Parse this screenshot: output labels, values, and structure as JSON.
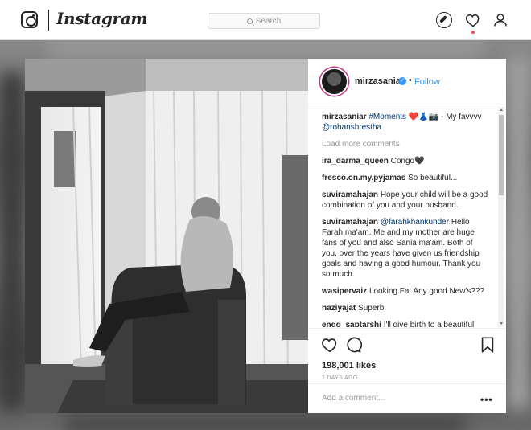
{
  "nav": {
    "logo_icon": "instagram-camera-icon",
    "brand": "Instagram",
    "search_placeholder": "Search",
    "icons": [
      "compass-icon",
      "heart-icon",
      "person-icon"
    ],
    "notification_dot_color": "#ed4956"
  },
  "post": {
    "author": "mirzasaniar",
    "verified_icon": "verified-badge-icon",
    "separator": "•",
    "follow_label": "Follow",
    "caption_user": "mirzasaniar",
    "caption_hashtag": "#Moments",
    "caption_emoji": "❤️👗📷",
    "caption_text": "- My favvvv",
    "caption_mention": "@rohanshrestha",
    "load_more": "Load more comments",
    "comments": [
      {
        "user": "ira_darma_queen",
        "text": "Congo🖤"
      },
      {
        "user": "fresco.on.my.pyjamas",
        "text": "So beautiful..."
      },
      {
        "user": "suviramahajan",
        "text": "Hope your child will be a good combination of you and your husband."
      },
      {
        "user": "suviramahajan",
        "mention": "@farahkhankunder",
        "text": "Hello Farah ma'am. Me and my mother are huge fans of you and also Sania ma'am. Both of you, over the years have given us friendship goals and having a good humour. Thank you so much."
      },
      {
        "user": "wasipervaiz",
        "text": "Looking Fat Any good New's???"
      },
      {
        "user": "naziyajat",
        "text": "Superb"
      },
      {
        "user": "engg_saptarshi",
        "text": "I'll give birth to a beautiful"
      }
    ],
    "likes": "198,001 likes",
    "time": "2 DAYS AGO",
    "add_comment_placeholder": "Add a comment...",
    "options": "•••"
  },
  "colors": {
    "accent_blue": "#3897f0",
    "mention": "#003569",
    "muted": "#999999"
  }
}
